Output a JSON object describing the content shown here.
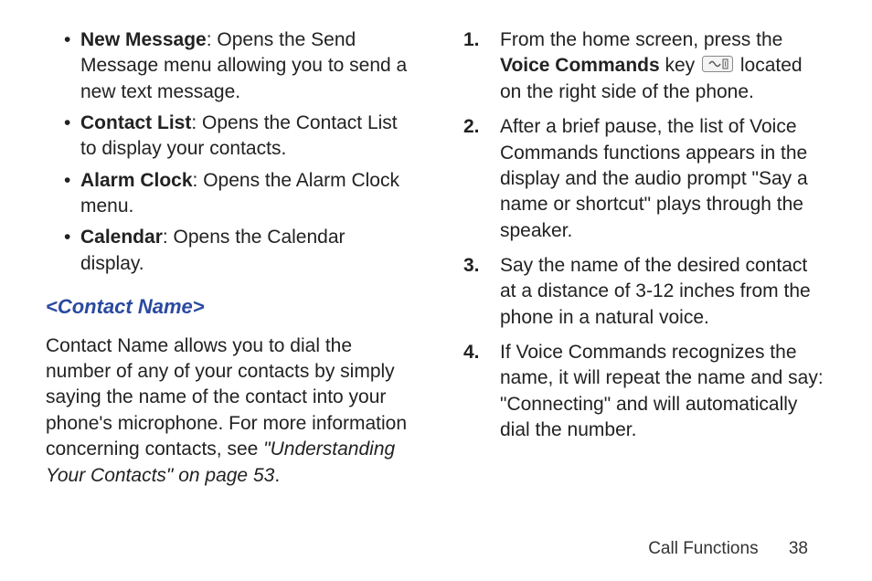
{
  "left": {
    "bullets": [
      {
        "label": "New Message",
        "desc": ": Opens the Send Message menu allowing you to send a new text message."
      },
      {
        "label": "Contact List",
        "desc": ": Opens the Contact List to display your contacts."
      },
      {
        "label": "Alarm Clock",
        "desc": ": Opens the Alarm Clock menu."
      },
      {
        "label": "Calendar",
        "desc": ": Opens the Calendar display."
      }
    ],
    "heading": "<Contact Name>",
    "para_pre": "Contact Name allows you to dial the number of any of your contacts by simply saying the name of the contact into your phone's microphone. For more information concerning contacts, see ",
    "para_ital": "\"Understanding Your Contacts\" on page 53",
    "para_post": "."
  },
  "right": {
    "steps": [
      {
        "num": "1.",
        "pre": "From the home screen, press the ",
        "bold": "Voice Commands",
        "mid": " key ",
        "post": " located on the right side of the phone."
      },
      {
        "num": "2.",
        "text": "After a brief pause, the list of Voice Commands functions appears in the display and the audio prompt \"Say a name or shortcut\" plays through the speaker."
      },
      {
        "num": "3.",
        "text": "Say the name of the desired contact at a distance of 3-12 inches from the phone in a natural voice."
      },
      {
        "num": "4.",
        "text": "If Voice Commands recognizes the name, it will repeat the name and say: \"Connecting\" and will automatically dial the number."
      }
    ]
  },
  "footer": {
    "section": "Call Functions",
    "page": "38"
  },
  "icons": {
    "voice_key": "voice-commands-key-icon"
  }
}
